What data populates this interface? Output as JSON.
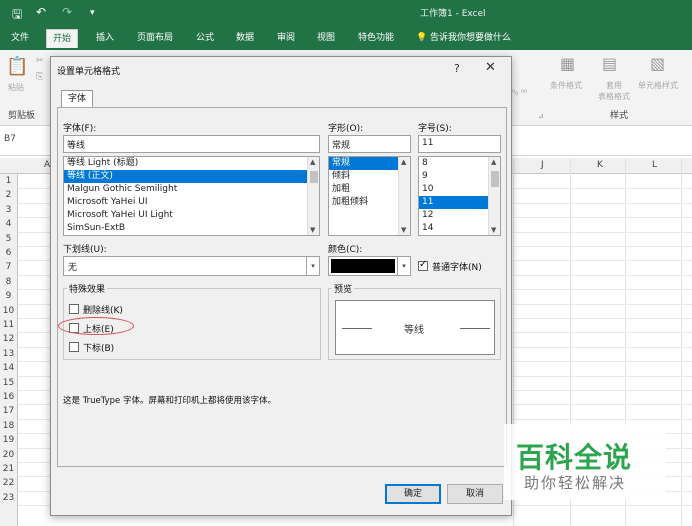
{
  "excel": {
    "window_title": "工作簿1 - Excel",
    "tabs": [
      "文件",
      "开始",
      "插入",
      "页面布局",
      "公式",
      "数据",
      "审阅",
      "视图",
      "特色功能"
    ],
    "active_tab": "开始",
    "tell_me": "告诉我你想要做什么",
    "ribbon": {
      "paste": "粘贴",
      "clipboard_group": "剪贴板",
      "conditional_format": "条件格式",
      "format_as_table": "套用\n表格格式",
      "cell_styles": "单元格样式",
      "styles_group": "样式"
    },
    "name_box": "B7",
    "columns": [
      "A",
      "J",
      "K",
      "L"
    ],
    "rows": [
      "1",
      "2",
      "3",
      "4",
      "5",
      "6",
      "7",
      "8",
      "9",
      "10",
      "11",
      "12",
      "13",
      "14",
      "15",
      "16",
      "17",
      "18",
      "19",
      "20",
      "21",
      "22",
      "23"
    ]
  },
  "dialog": {
    "title": "设置单元格格式",
    "help": "?",
    "close": "✕",
    "tab": "字体",
    "font_label": "字体(F):",
    "font_value": "等线",
    "font_list": [
      "等线 Light (标题)",
      "等线 (正文)",
      "Malgun Gothic Semilight",
      "Microsoft YaHei UI",
      "Microsoft YaHei UI Light",
      "SimSun-ExtB"
    ],
    "font_selected_index": 1,
    "style_label": "字形(O):",
    "style_value": "常规",
    "style_list": [
      "常规",
      "倾斜",
      "加粗",
      "加粗倾斜"
    ],
    "style_selected_index": 0,
    "size_label": "字号(S):",
    "size_value": "11",
    "size_list": [
      "8",
      "9",
      "10",
      "11",
      "12",
      "14"
    ],
    "size_selected_index": 3,
    "underline_label": "下划线(U):",
    "underline_value": "无",
    "color_label": "颜色(C):",
    "color_swatch": "#000000",
    "normal_font_label": "普通字体(N)",
    "normal_font_checked": true,
    "effects_label": "特殊效果",
    "strikethrough": "删除线(K)",
    "superscript": "上标(E)",
    "subscript": "下标(B)",
    "preview_label": "预览",
    "preview_text": "等线",
    "note": "这是 TrueType 字体。屏幕和打印机上都将使用该字体。",
    "ok": "确定",
    "cancel": "取消",
    "highlight_color": "#d9534f"
  },
  "watermark": {
    "main": "百科全说",
    "sub": "助你轻松解决"
  }
}
